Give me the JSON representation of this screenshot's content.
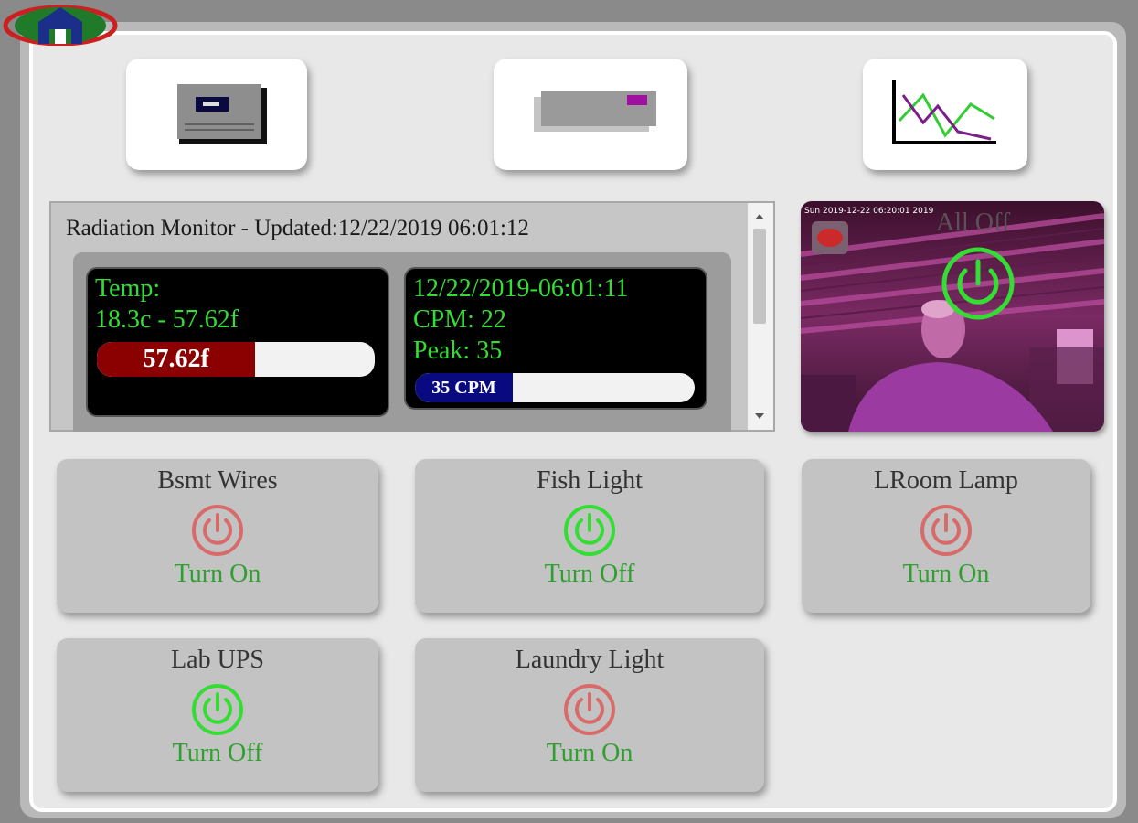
{
  "logo": {
    "icon": "house-logo-icon"
  },
  "nav": [
    {
      "name": "device-panel-icon"
    },
    {
      "name": "ups-device-icon"
    },
    {
      "name": "line-chart-icon"
    }
  ],
  "radiation": {
    "title": "Radiation Monitor - Updated:12/22/2019 06:01:12",
    "temp": {
      "label": "Temp:",
      "value": "18.3c - 57.62f",
      "bar_label": "57.62f",
      "level": 0.57,
      "color": "#8b0000"
    },
    "cpm": {
      "timestamp": "12/22/2019-06:01:11",
      "cpm": "CPM: 22",
      "peak": "Peak: 35",
      "bar_label": "35 CPM",
      "level": 0.35,
      "color": "#0a0a80"
    }
  },
  "camera": {
    "timestamp": "Sun 2019-12-22 06:20:01 2019",
    "all_off_label": "All Off"
  },
  "colors": {
    "on": "#33dd33",
    "off": "#d96a6a"
  },
  "devices": [
    {
      "name": "Bsmt Wires",
      "action": "Turn On",
      "state": "off"
    },
    {
      "name": "Fish Light",
      "action": "Turn Off",
      "state": "on"
    },
    {
      "name": "LRoom Lamp",
      "action": "Turn On",
      "state": "off"
    },
    {
      "name": "Lab UPS",
      "action": "Turn Off",
      "state": "on"
    },
    {
      "name": "Laundry Light",
      "action": "Turn On",
      "state": "off"
    }
  ]
}
